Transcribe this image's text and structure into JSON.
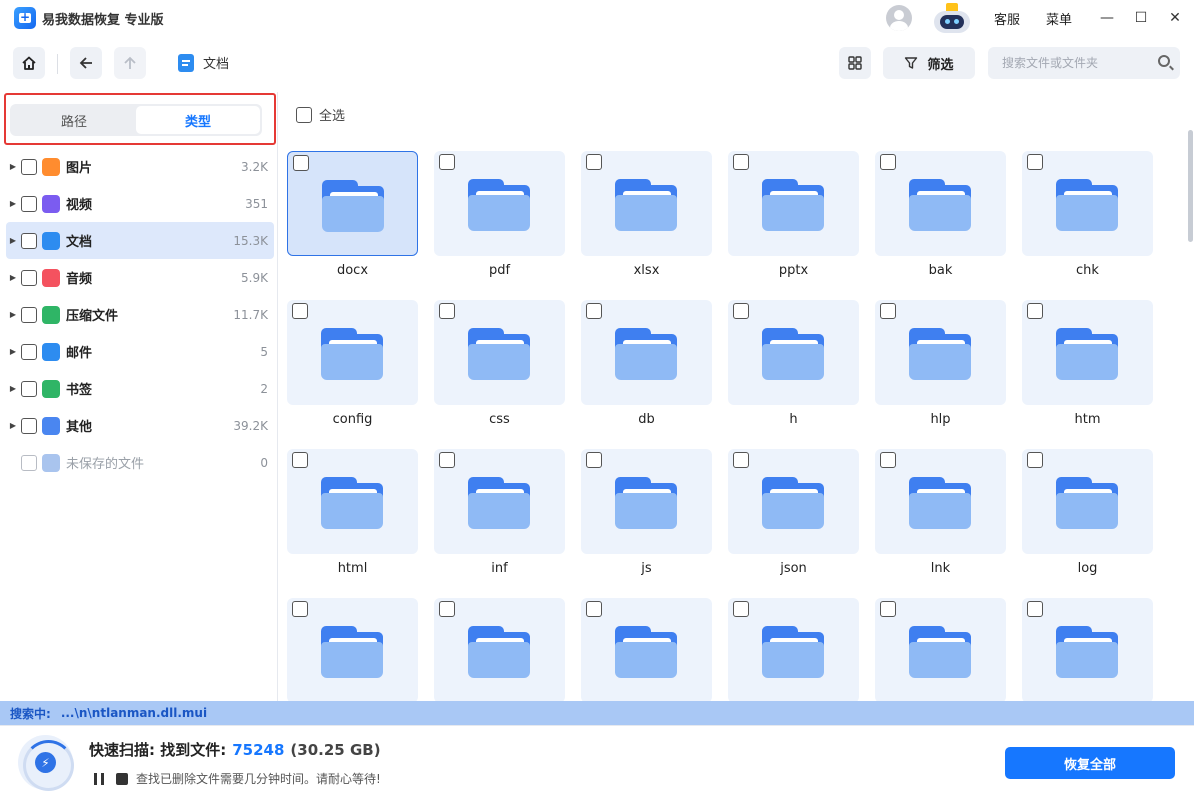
{
  "app": {
    "title": "易我数据恢复 专业版"
  },
  "titlebar": {
    "service": "客服",
    "menu": "菜单"
  },
  "toolbar": {
    "crumb": "文档",
    "filter": "筛选",
    "search_placeholder": "搜索文件或文件夹"
  },
  "sidebar": {
    "tabs": [
      "路径",
      "类型"
    ],
    "active_tab": "类型",
    "items": [
      {
        "label": "图片",
        "count": "3.2K",
        "icon": "image-icon",
        "color": "#ff8c2f"
      },
      {
        "label": "视频",
        "count": "351",
        "icon": "video-icon",
        "color": "#7b5cf0"
      },
      {
        "label": "文档",
        "count": "15.3K",
        "icon": "document-icon",
        "color": "#2d8cf0"
      },
      {
        "label": "音频",
        "count": "5.9K",
        "icon": "audio-icon",
        "color": "#f4525f"
      },
      {
        "label": "压缩文件",
        "count": "11.7K",
        "icon": "archive-icon",
        "color": "#2fb566"
      },
      {
        "label": "邮件",
        "count": "5",
        "icon": "mail-icon",
        "color": "#2d8cf0"
      },
      {
        "label": "书签",
        "count": "2",
        "icon": "bookmark-icon",
        "color": "#2fb566"
      },
      {
        "label": "其他",
        "count": "39.2K",
        "icon": "folder-other-icon",
        "color": "#4a86f0"
      },
      {
        "label": "未保存的文件",
        "count": "0",
        "icon": "unsaved-icon",
        "color": "#a9c4ee"
      }
    ]
  },
  "main": {
    "select_all": "全选",
    "folders": [
      "docx",
      "pdf",
      "xlsx",
      "pptx",
      "bak",
      "chk",
      "config",
      "css",
      "db",
      "h",
      "hlp",
      "htm",
      "html",
      "inf",
      "js",
      "json",
      "lnk",
      "log",
      "",
      "",
      "",
      "",
      "",
      ""
    ]
  },
  "status": {
    "label": "搜索中:",
    "path": "...\\n\\ntlanman.dll.mui"
  },
  "scan": {
    "title": "快速扫描: 找到文件:",
    "count": "75248",
    "size": "(30.25 GB)",
    "hint": "查找已删除文件需要几分钟时间。请耐心等待!",
    "recover_all": "恢复全部"
  }
}
